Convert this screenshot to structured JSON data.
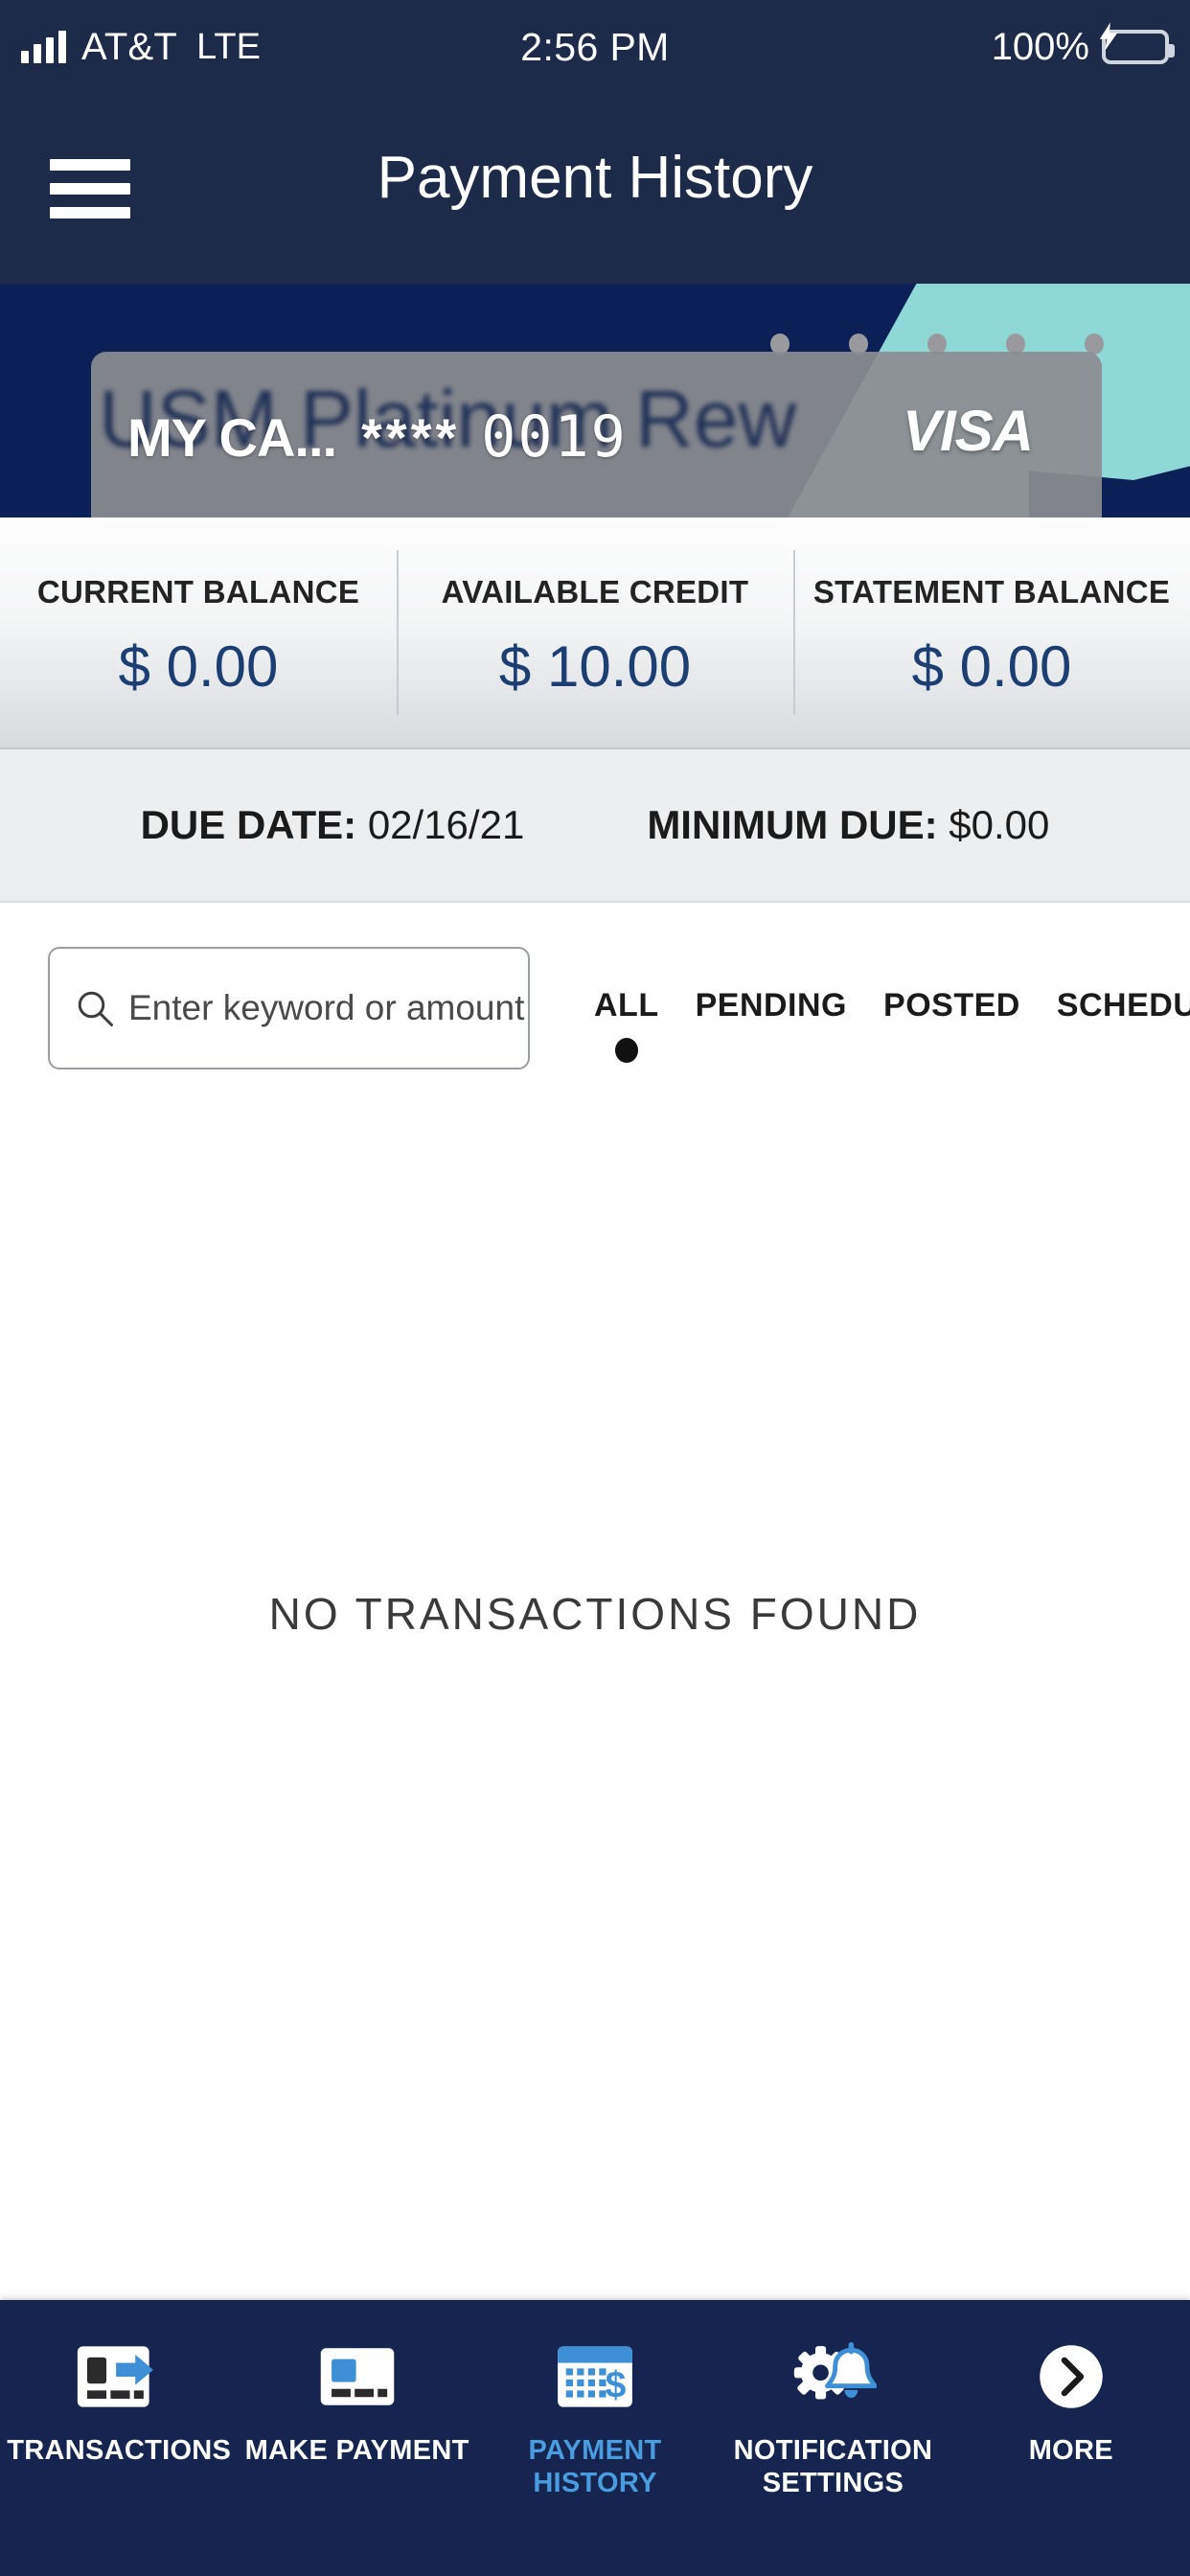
{
  "statusbar": {
    "carrier": "AT&T",
    "network": "LTE",
    "time": "2:56 PM",
    "battery_percent": "100%",
    "battery_color": "#3ad14e"
  },
  "header": {
    "title": "Payment History",
    "menu_icon": "hamburger-icon"
  },
  "card": {
    "background_name": "USM Platinum Rew",
    "nickname": "MY CA...",
    "mask": "****",
    "last_four": "0019",
    "network_logo": "VISA",
    "carousel_dots": 5,
    "band_color": "#0a2056",
    "accent_color": "#8fd8d8"
  },
  "balances": [
    {
      "label": "CURRENT BALANCE",
      "value": "$ 0.00"
    },
    {
      "label": "AVAILABLE CREDIT",
      "value": "$ 10.00"
    },
    {
      "label": "STATEMENT BALANCE",
      "value": "$ 0.00"
    }
  ],
  "due": {
    "due_date_label": "DUE DATE:",
    "due_date_value": "02/16/21",
    "minimum_due_label": "MINIMUM DUE:",
    "minimum_due_value": "$0.00"
  },
  "search": {
    "placeholder": "Enter keyword or amount",
    "value": "",
    "icon": "search-icon"
  },
  "filters": [
    {
      "label": "ALL",
      "selected": true
    },
    {
      "label": "PENDING",
      "selected": false
    },
    {
      "label": "POSTED",
      "selected": false
    },
    {
      "label": "SCHEDULED",
      "selected": false
    }
  ],
  "empty_state": {
    "message": "NO TRANSACTIONS FOUND"
  },
  "bottom_nav": {
    "active_color": "#4a9ce0",
    "background": "#152550",
    "items": [
      {
        "label": "TRANSACTIONS",
        "icon": "card-arrow-icon",
        "active": false
      },
      {
        "label": "MAKE PAYMENT",
        "icon": "credit-card-icon",
        "active": false
      },
      {
        "label": "PAYMENT HISTORY",
        "icon": "calendar-dollar-icon",
        "active": true
      },
      {
        "label": "NOTIFICATION SETTINGS",
        "icon": "gear-bell-icon",
        "active": false
      },
      {
        "label": "MORE",
        "icon": "chevron-right-circle-icon",
        "active": false
      }
    ]
  }
}
